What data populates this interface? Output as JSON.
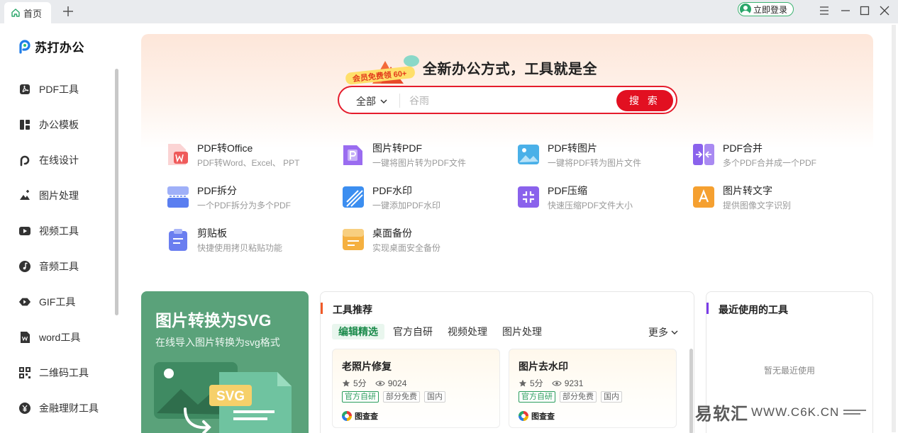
{
  "titlebar": {
    "tab_label": "首页",
    "login_label": "立即登录"
  },
  "sidebar": {
    "logo_text": "苏打办公",
    "items": [
      {
        "label": "PDF工具",
        "icon": "pdf-icon"
      },
      {
        "label": "办公模板",
        "icon": "template-icon"
      },
      {
        "label": "在线设计",
        "icon": "design-icon"
      },
      {
        "label": "图片处理",
        "icon": "image-edit-icon"
      },
      {
        "label": "视频工具",
        "icon": "video-icon"
      },
      {
        "label": "音频工具",
        "icon": "music-icon"
      },
      {
        "label": "GIF工具",
        "icon": "gif-icon"
      },
      {
        "label": "word工具",
        "icon": "word-icon"
      },
      {
        "label": "二维码工具",
        "icon": "qrcode-icon"
      },
      {
        "label": "金融理财工具",
        "icon": "finance-icon"
      }
    ]
  },
  "hero": {
    "badge": "会员免费领 60+",
    "slogan": "全新办公方式，工具就是全",
    "search": {
      "scope": "全部",
      "placeholder": "谷雨",
      "button": "搜 索"
    },
    "tools": [
      {
        "name": "PDF转Office",
        "desc": "PDF转Word、Excel、 PPT",
        "icon": "pdf-to-office-icon",
        "color": "#f06a6a"
      },
      {
        "name": "图片转PDF",
        "desc": "一键将图片转为PDF文件",
        "icon": "image-to-pdf-icon",
        "color": "#9a6cf0"
      },
      {
        "name": "PDF转图片",
        "desc": "一键将PDF转为图片文件",
        "icon": "pdf-to-image-icon",
        "color": "#4ab0e8"
      },
      {
        "name": "PDF合并",
        "desc": "多个PDF合并成一个PDF",
        "icon": "pdf-merge-icon",
        "color": "#8a62ec"
      },
      {
        "name": "PDF拆分",
        "desc": "一个PDF拆分为多个PDF",
        "icon": "pdf-split-icon",
        "color": "#5a7ef0"
      },
      {
        "name": "PDF水印",
        "desc": "一键添加PDF水印",
        "icon": "pdf-watermark-icon",
        "color": "#3c8ef0"
      },
      {
        "name": "PDF压缩",
        "desc": "快速压缩PDF文件大小",
        "icon": "pdf-compress-icon",
        "color": "#8a62ec"
      },
      {
        "name": "图片转文字",
        "desc": "提供图像文字识别",
        "icon": "ocr-icon",
        "color": "#f5a030"
      },
      {
        "name": "剪贴板",
        "desc": "快捷使用拷贝粘贴功能",
        "icon": "clipboard-icon",
        "color": "#6a7ef0"
      },
      {
        "name": "桌面备份",
        "desc": "实现桌面安全备份",
        "icon": "desktop-backup-icon",
        "color": "#f5b040"
      }
    ]
  },
  "promo": {
    "title": "图片转换为SVG",
    "subtitle": "在线导入图片转换为svg格式",
    "svg_label": "SVG"
  },
  "recommend": {
    "title": "工具推荐",
    "tabs": [
      "编辑精选",
      "官方自研",
      "视频处理",
      "图片处理"
    ],
    "more": "更多",
    "cards": [
      {
        "title": "老照片修复",
        "rating": "5分",
        "views": "9024",
        "tags": [
          "官方自研",
          "部分免费",
          "国内"
        ],
        "brand": "图查查"
      },
      {
        "title": "图片去水印",
        "rating": "5分",
        "views": "9231",
        "tags": [
          "官方自研",
          "部分免费",
          "国内"
        ],
        "brand": "图查查"
      }
    ]
  },
  "recent": {
    "title": "最近使用的工具",
    "empty": "暂无最近使用"
  },
  "watermark": {
    "cn": "易软汇",
    "en": "WWW.C6K.CN"
  },
  "colors": {
    "accent_red": "#e21021",
    "green": "#2a9d5c",
    "recommend_bar": "#f05a28",
    "recent_bar": "#7a3ce8"
  }
}
